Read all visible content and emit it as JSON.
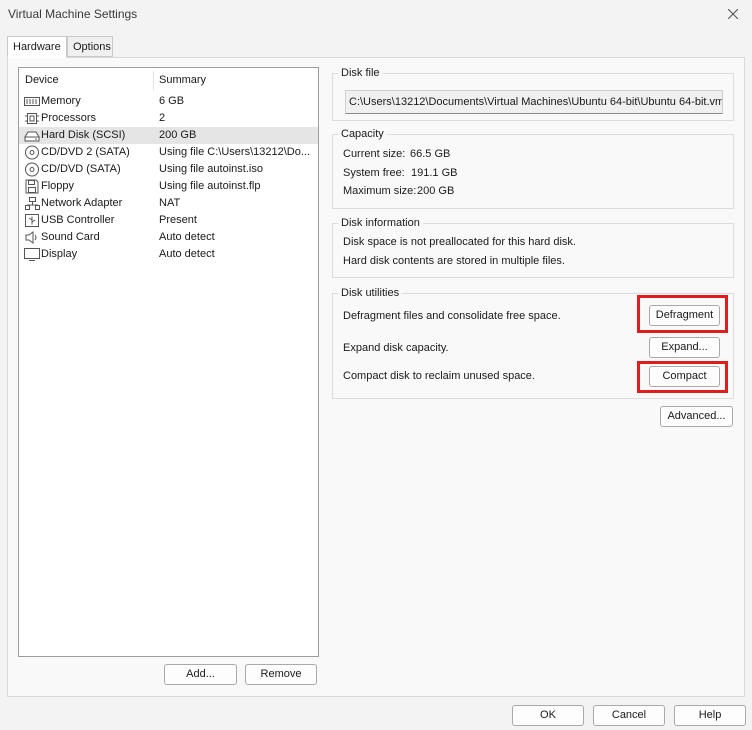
{
  "window": {
    "title": "Virtual Machine Settings"
  },
  "tabs": [
    "Hardware",
    "Options"
  ],
  "device_list": {
    "columns": [
      "Device",
      "Summary"
    ],
    "rows": [
      {
        "device": "Memory",
        "summary": "6 GB",
        "icon": "memory-icon"
      },
      {
        "device": "Processors",
        "summary": "2",
        "icon": "processor-icon"
      },
      {
        "device": "Hard Disk (SCSI)",
        "summary": "200 GB",
        "icon": "hard-disk-icon"
      },
      {
        "device": "CD/DVD 2 (SATA)",
        "summary": "Using file C:\\Users\\13212\\Do...",
        "icon": "cd-dvd-icon"
      },
      {
        "device": "CD/DVD (SATA)",
        "summary": "Using file autoinst.iso",
        "icon": "cd-dvd-icon"
      },
      {
        "device": "Floppy",
        "summary": "Using file autoinst.flp",
        "icon": "floppy-icon"
      },
      {
        "device": "Network Adapter",
        "summary": "NAT",
        "icon": "network-adapter-icon"
      },
      {
        "device": "USB Controller",
        "summary": "Present",
        "icon": "usb-icon"
      },
      {
        "device": "Sound Card",
        "summary": "Auto detect",
        "icon": "speaker-icon"
      },
      {
        "device": "Display",
        "summary": "Auto detect",
        "icon": "monitor-icon"
      }
    ],
    "selected": "Hard Disk (SCSI)",
    "add_label": "Add...",
    "remove_label": "Remove"
  },
  "disk_file": {
    "title": "Disk file",
    "path": "C:\\Users\\13212\\Documents\\Virtual Machines\\Ubuntu 64-bit\\Ubuntu 64-bit.vm"
  },
  "capacity": {
    "title": "Capacity",
    "current_size_label": "Current size:",
    "current_size": "66.5 GB",
    "system_free_label": "System free:",
    "system_free": "191.1 GB",
    "maximum_size_label": "Maximum size:",
    "maximum_size": "200 GB"
  },
  "disk_information": {
    "title": "Disk information",
    "line1": "Disk space is not preallocated for this hard disk.",
    "line2": "Hard disk contents are stored in multiple files."
  },
  "disk_utilities": {
    "title": "Disk utilities",
    "defragment_text": "Defragment files and consolidate free space.",
    "defragment_label": "Defragment",
    "expand_text": "Expand disk capacity.",
    "expand_label": "Expand...",
    "compact_text": "Compact disk to reclaim unused space.",
    "compact_label": "Compact"
  },
  "advanced_label": "Advanced...",
  "footer": {
    "ok_label": "OK",
    "cancel_label": "Cancel",
    "help_label": "Help"
  },
  "colors": {
    "highlight": "#e01d1d",
    "selected_row": "#e5e5e5"
  }
}
